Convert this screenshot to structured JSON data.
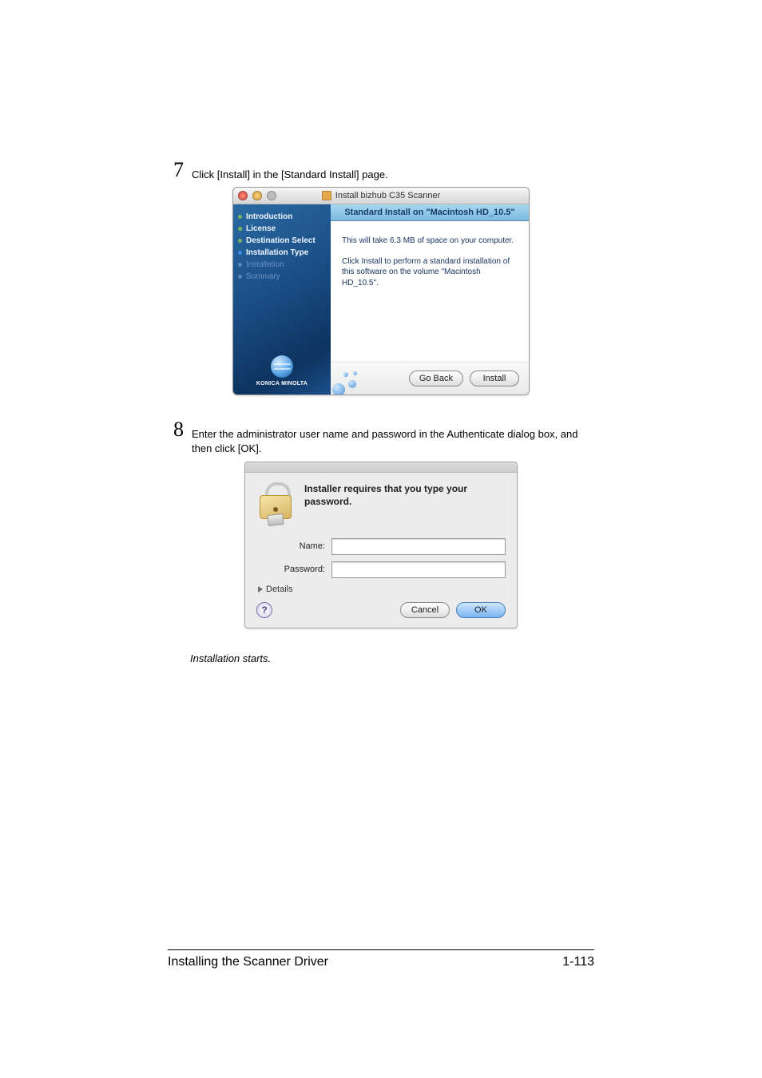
{
  "steps": {
    "s7": {
      "num": "7",
      "text": "Click [Install] in the [Standard Install] page."
    },
    "s8": {
      "num": "8",
      "text": "Enter the administrator user name and password in the Authenticate dialog box, and then click [OK]."
    }
  },
  "installer": {
    "window_title": "Install bizhub C35 Scanner",
    "header": "Standard Install on \"Macintosh HD_10.5\"",
    "nav": {
      "introduction": "Introduction",
      "license": "License",
      "destination": "Destination Select",
      "install_type": "Installation Type",
      "installation": "Installation",
      "summary": "Summary"
    },
    "body": {
      "line1": "This will take 6.3 MB of space on your computer.",
      "line2": "Click Install to perform a standard installation of this software on the volume \"Macintosh HD_10.5\"."
    },
    "logo_text": "KONICA MINOLTA",
    "buttons": {
      "go_back": "Go Back",
      "install": "Install"
    }
  },
  "auth": {
    "message": "Installer requires that you type your password.",
    "name_label": "Name:",
    "password_label": "Password:",
    "name_value": "",
    "password_value": "",
    "details": "Details",
    "help_glyph": "?",
    "cancel": "Cancel",
    "ok": "OK"
  },
  "note": "Installation starts.",
  "footer": {
    "title": "Installing the Scanner Driver",
    "page": "1-113"
  }
}
